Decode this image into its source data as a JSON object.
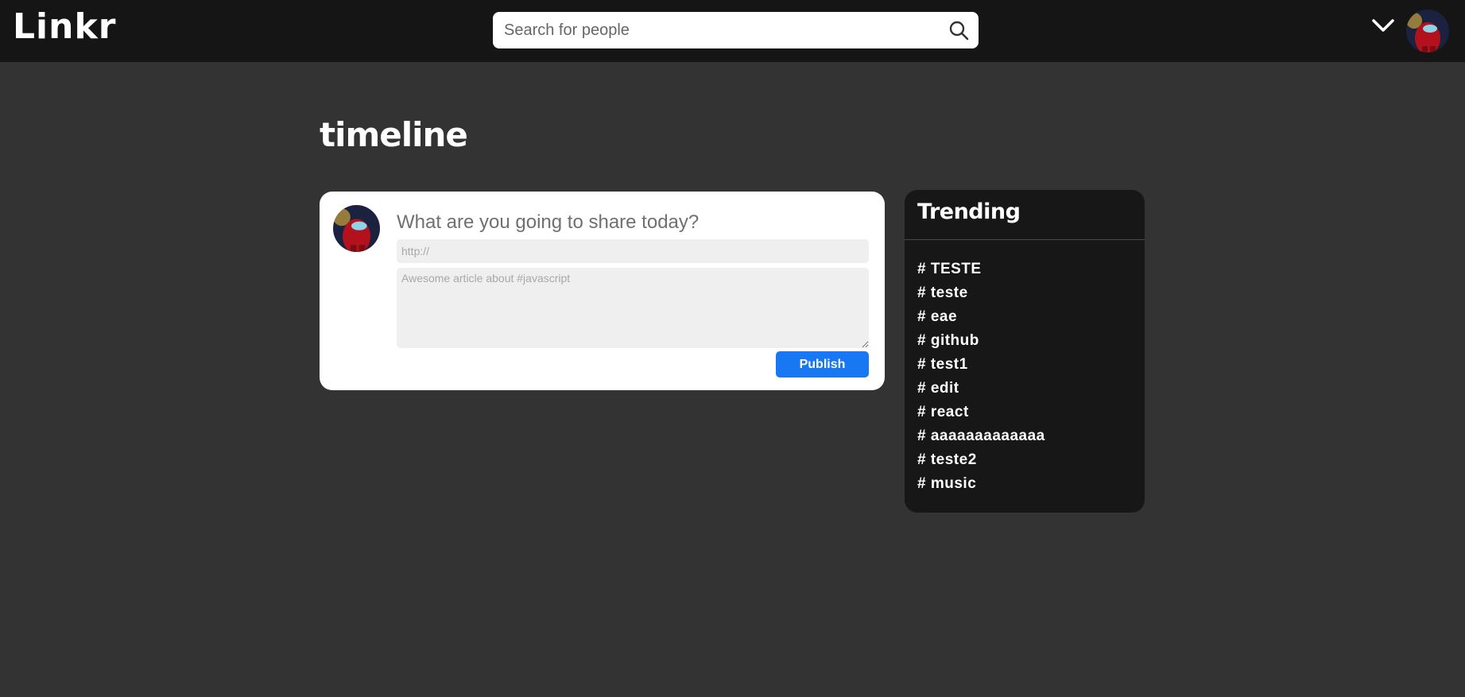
{
  "header": {
    "logo": "Linkr",
    "search": {
      "placeholder": "Search for people",
      "value": ""
    },
    "icons": {
      "search": "search-icon",
      "menu": "chevron-down-icon"
    }
  },
  "main": {
    "title": "timeline",
    "composer": {
      "prompt": "What are you going to share today?",
      "url_placeholder": "http://",
      "url_value": "",
      "description_placeholder": "Awesome article about #javascript",
      "description_value": "",
      "publish_label": "Publish"
    }
  },
  "trending": {
    "title": "Trending",
    "hashtags": [
      "# TESTE",
      "# teste",
      "# eae",
      "# github",
      "# test1",
      "# edit",
      "# react",
      "# aaaaaaaaaaaaa",
      "# teste2",
      "# music"
    ]
  },
  "colors": {
    "background": "#333333",
    "header": "#151515",
    "trending_panel": "#171717",
    "publish_button": "#1877f2"
  }
}
